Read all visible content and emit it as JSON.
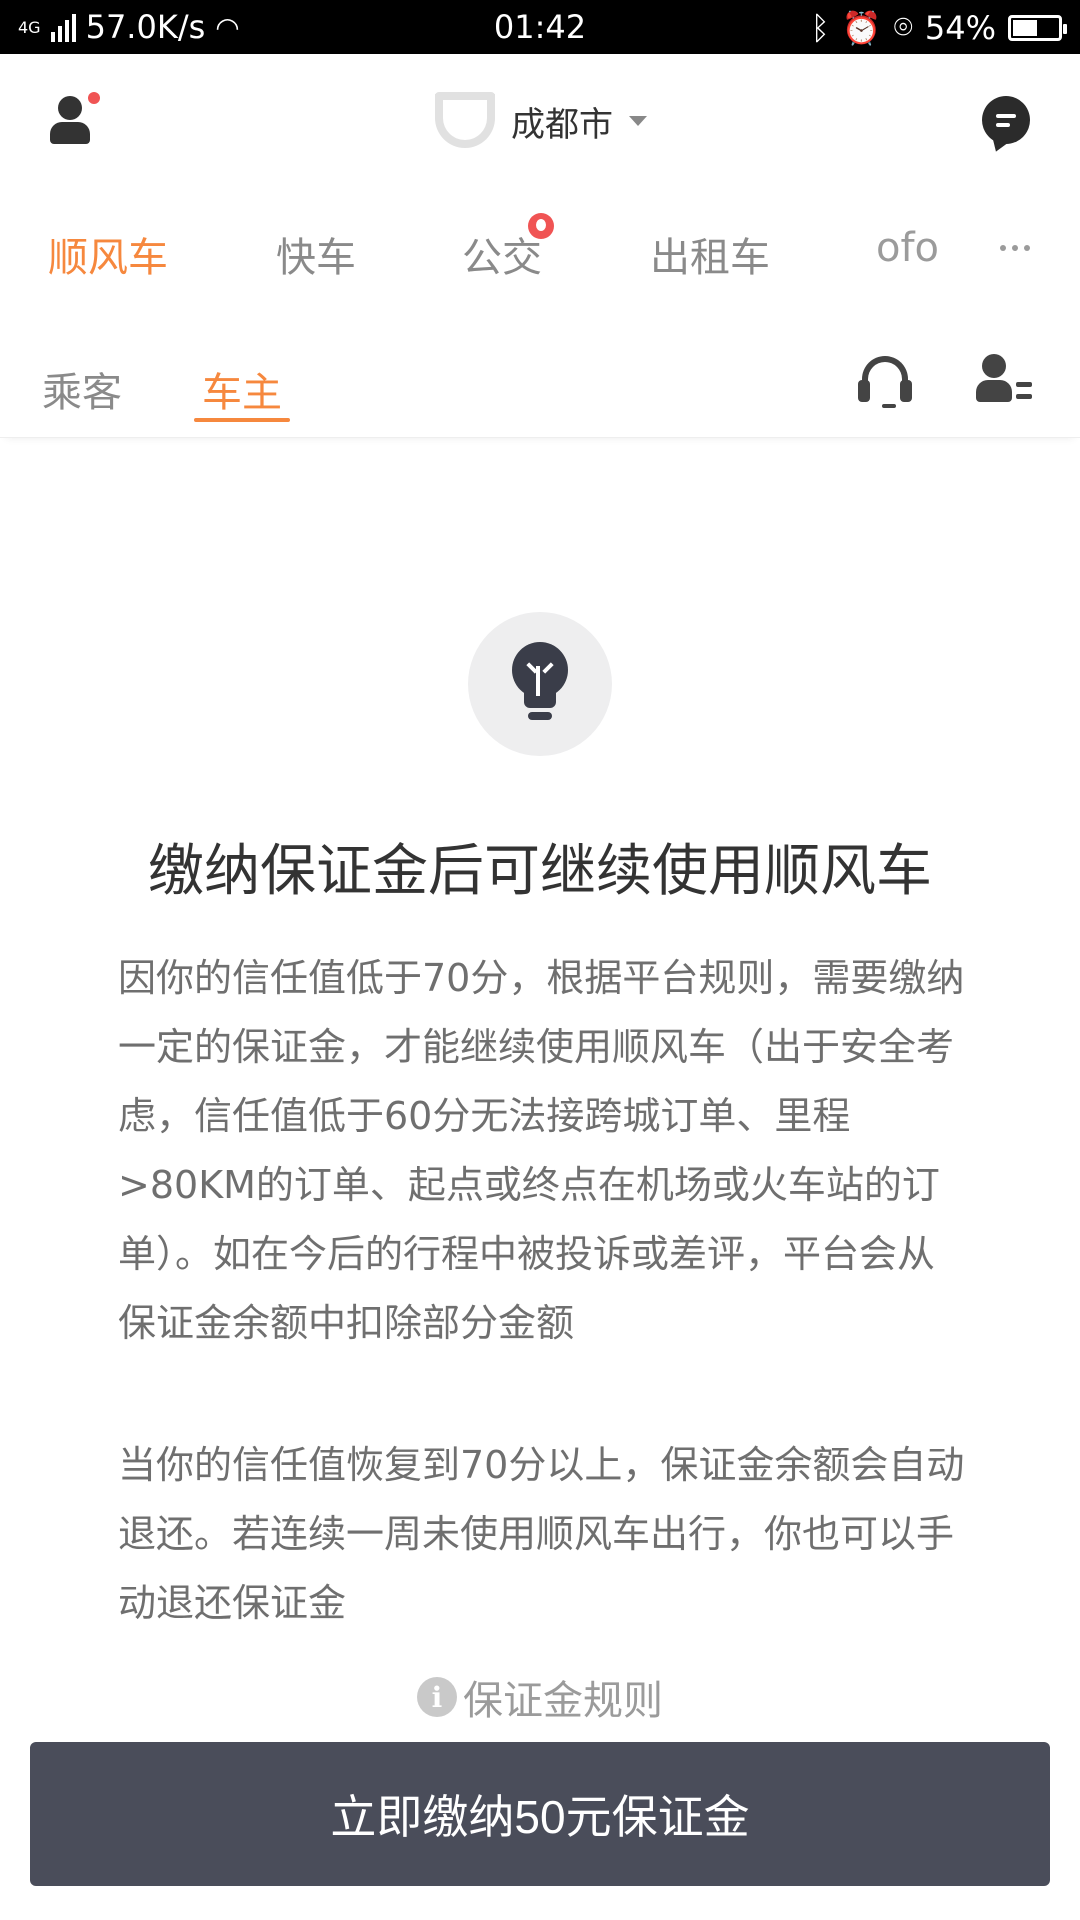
{
  "status_bar": {
    "network_type": "4G",
    "speed": "57.0K/s",
    "time": "01:42",
    "battery": "54%",
    "battery_level": 0.54
  },
  "header": {
    "city": "成都市"
  },
  "service_tabs": [
    {
      "label": "顺风车",
      "active": true
    },
    {
      "label": "快车",
      "active": false
    },
    {
      "label": "公交",
      "active": false,
      "badge": "fire-icon"
    },
    {
      "label": "出租车",
      "active": false
    },
    {
      "label": "ofo",
      "active": false
    }
  ],
  "role_tabs": [
    {
      "label": "乘客",
      "active": false
    },
    {
      "label": "车主",
      "active": true
    }
  ],
  "content": {
    "title": "缴纳保证金后可继续使用顺风车",
    "paragraph1": "因你的信任值低于70分，根据平台规则，需要缴纳一定的保证金，才能继续使用顺风车（出于安全考虑，信任值低于60分无法接跨城订单、里程>80KM的订单、起点或终点在机场或火车站的订单）。如在今后的行程中被投诉或差评，平台会从保证金余额中扣除部分金额",
    "paragraph2": "当你的信任值恢复到70分以上，保证金余额会自动退还。若连续一周未使用顺风车出行，你也可以手动退还保证金",
    "rules_link": "保证金规则",
    "pay_button": "立即缴纳50元保证金"
  },
  "colors": {
    "accent": "#f6883e",
    "button_bg": "#4a4d5a",
    "badge_red": "#f05454"
  }
}
